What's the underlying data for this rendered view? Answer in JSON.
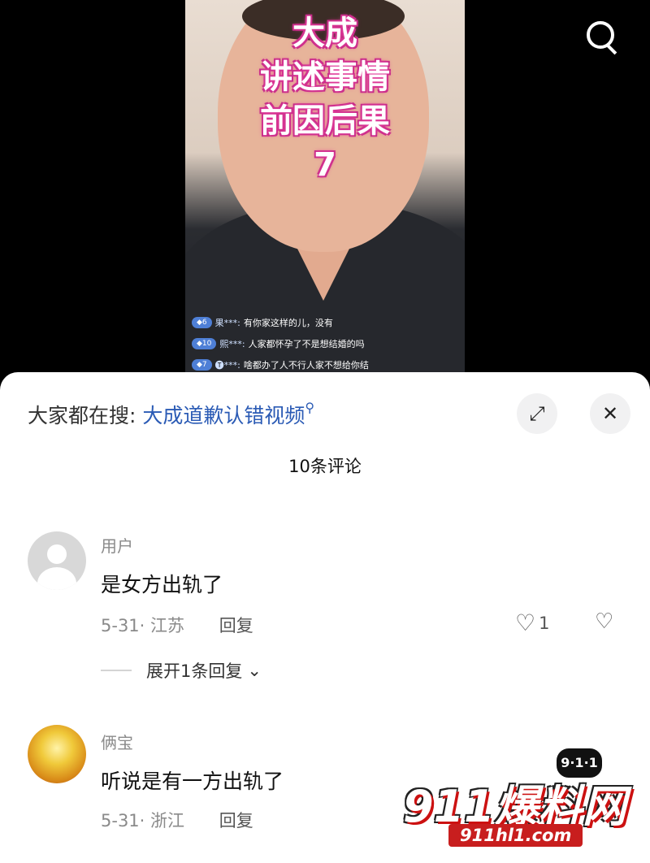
{
  "video": {
    "overlay_lines": [
      "大成",
      "讲述事情",
      "前因后果",
      "7"
    ],
    "live_comments": [
      {
        "level": "6",
        "user": "果***:",
        "text": "有你家这样的儿，没有"
      },
      {
        "level": "10",
        "user": "熙***:",
        "text": "人家都怀孕了不是想结婚的吗"
      },
      {
        "level": "7",
        "user": "🅣***:",
        "text": "啥都办了人不行人家不想给你结"
      }
    ],
    "search_icon": "search-icon"
  },
  "sheet": {
    "hot_prefix": "大家都在搜:",
    "hot_keyword": "大成道歉认错视频",
    "expand_icon": "expand-icon",
    "close_icon": "close-icon",
    "count_label": "10条评论"
  },
  "comments": [
    {
      "user": "用户",
      "text": "是女方出轨了",
      "date_loc": "5-31· 江苏",
      "reply_label": "回复",
      "likes": "1",
      "expand_label": "展开1条回复"
    },
    {
      "user": "俩宝",
      "text": "听说是有一方出轨了",
      "date_loc": "5-31· 浙江",
      "reply_label": "回复"
    }
  ],
  "watermark": {
    "badge": "9·1·1",
    "brand": "911爆料网",
    "site": "911hl1.com"
  }
}
